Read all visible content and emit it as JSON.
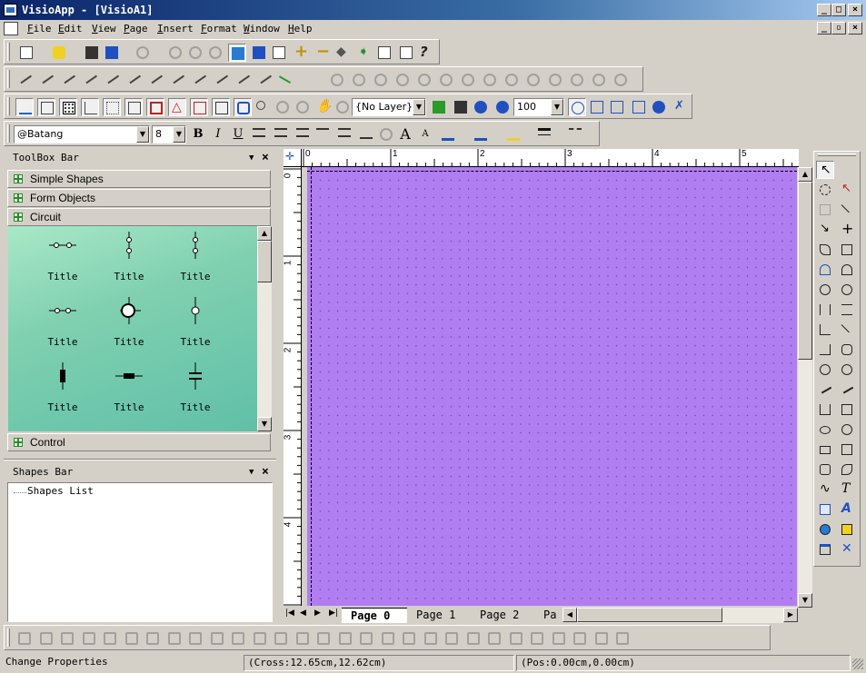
{
  "window": {
    "title": "VisioApp - [VisioA1]",
    "caption_buttons": [
      "_",
      "□",
      "×"
    ],
    "child_buttons": [
      "_",
      "▫",
      "×"
    ]
  },
  "menu": [
    "File",
    "Edit",
    "View",
    "Page",
    "Insert",
    "Format",
    "Window",
    "Help"
  ],
  "toolbar_layer": {
    "layer_value": "{No Layer}",
    "zoom_value": "100"
  },
  "toolbar_format": {
    "font_value": "@Batang",
    "size_value": "8",
    "bold": "B",
    "italic": "I",
    "underline": "U",
    "font_grow": "A",
    "font_shrink": "A"
  },
  "toolbox": {
    "title": "ToolBox Bar",
    "categories": [
      "Simple Shapes",
      "Form Objects",
      "Circuit",
      "Control"
    ],
    "shape_label": "Title",
    "shape_labels": [
      "Title",
      "Title",
      "Title",
      "Title",
      "Title",
      "Title",
      "Title",
      "Title",
      "Title"
    ]
  },
  "shapes_bar": {
    "title": "Shapes Bar",
    "tree_root": "Shapes List"
  },
  "rulers": {
    "h_numbers": [
      "0",
      "1",
      "2",
      "3",
      "4",
      "5"
    ],
    "v_numbers": [
      "0",
      "1",
      "2",
      "3",
      "4"
    ]
  },
  "page_tabs": [
    "Page 0",
    "Page 1",
    "Page 2",
    "Pa"
  ],
  "status": {
    "message": "Change Properties",
    "cross": "(Cross:12.65cm,12.62cm)",
    "pos": "(Pos:0.00cm,0.00cm)"
  },
  "colors": {
    "canvas": "#b07ef0",
    "toolbox_bg": "#7fd0b0",
    "title_start": "#0a246a"
  }
}
